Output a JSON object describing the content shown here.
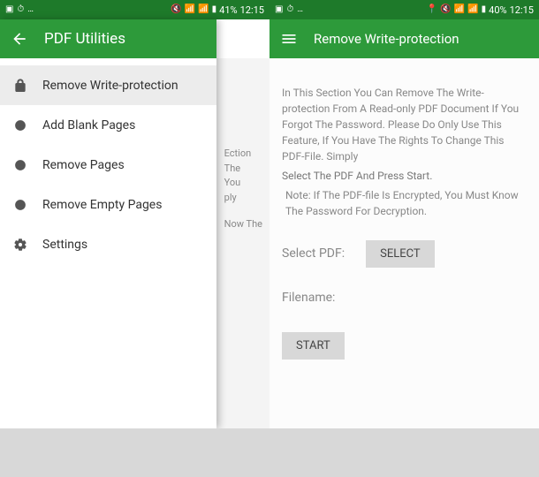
{
  "screen1": {
    "statusbar": {
      "battery": "41%",
      "time": "12:15"
    },
    "title": "PDF Utilities",
    "bg_text": {
      "l1": "Ection",
      "l2": "The",
      "l3": "You",
      "l4": "ply",
      "l5": "Now The"
    },
    "drawer": {
      "items": [
        {
          "label": "Remove Write-protection"
        },
        {
          "label": "Add Blank Pages"
        },
        {
          "label": "Remove Pages"
        },
        {
          "label": "Remove Empty Pages"
        },
        {
          "label": "Settings"
        }
      ]
    }
  },
  "screen2": {
    "statusbar": {
      "battery": "40%",
      "time": "12:15"
    },
    "title": "Remove Write-protection",
    "desc1": "In This Section You Can Remove The Write-protection From A Read-only PDF Document If You Forgot The Password. Please Do Only Use This Feature, If You Have The Rights To Change This PDF-File. Simply",
    "desc2": "Select The PDF And Press Start.",
    "note": "Note: If The PDF-file Is Encrypted, You Must Know The Password For Decryption.",
    "select_label": "Select PDF:",
    "select_btn": "SELECT",
    "filename_label": "Filename:",
    "start_btn": "START"
  }
}
